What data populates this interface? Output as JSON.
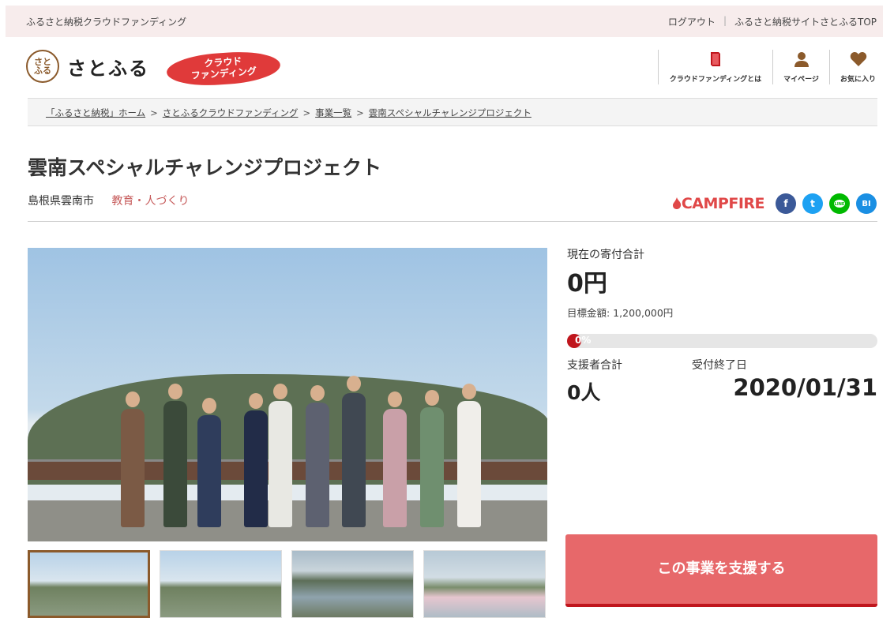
{
  "topbar": {
    "site_name": "ふるさと納税クラウドファンディング",
    "logout": "ログアウト",
    "separator": "|",
    "top_link": "ふるさと納税サイトさとふるTOP"
  },
  "header": {
    "logo_mark": "さと\nふる",
    "logo_text": "さとふる",
    "badge_line1": "クラウド",
    "badge_line2": "ファンディング",
    "nav": [
      {
        "label": "クラウドファンディングとは",
        "icon": "book-icon"
      },
      {
        "label": "マイページ",
        "icon": "person-icon"
      },
      {
        "label": "お気に入り",
        "icon": "heart-icon"
      }
    ]
  },
  "breadcrumb": [
    "「ふるさと納税」ホーム",
    "さとふるクラウドファンディング",
    "事業一覧",
    "雲南スペシャルチャレンジプロジェクト"
  ],
  "breadcrumb_sep": ">",
  "project": {
    "title": "雲南スペシャルチャレンジプロジェクト",
    "city": "島根県雲南市",
    "category": "教育・人づくり"
  },
  "share": {
    "campfire": "CAMPFIRE",
    "fb": "f",
    "tw": "t",
    "line": "LINE",
    "bi": "BI"
  },
  "funding": {
    "current_label": "現在の寄付合計",
    "current_amount": "0円",
    "goal": "目標金額: 1,200,000円",
    "progress_text": "0%",
    "progress_fraction": 0,
    "supporters_label": "支援者合計",
    "supporters_value": "0人",
    "deadline_label": "受付終了日",
    "deadline_value": "2020/01/31"
  },
  "support_button": "この事業を支援する",
  "colors": {
    "accent": "#e7686a",
    "progress": "#c0161d",
    "category": "#c65a5a",
    "topbar_bg": "#f7ecec"
  }
}
